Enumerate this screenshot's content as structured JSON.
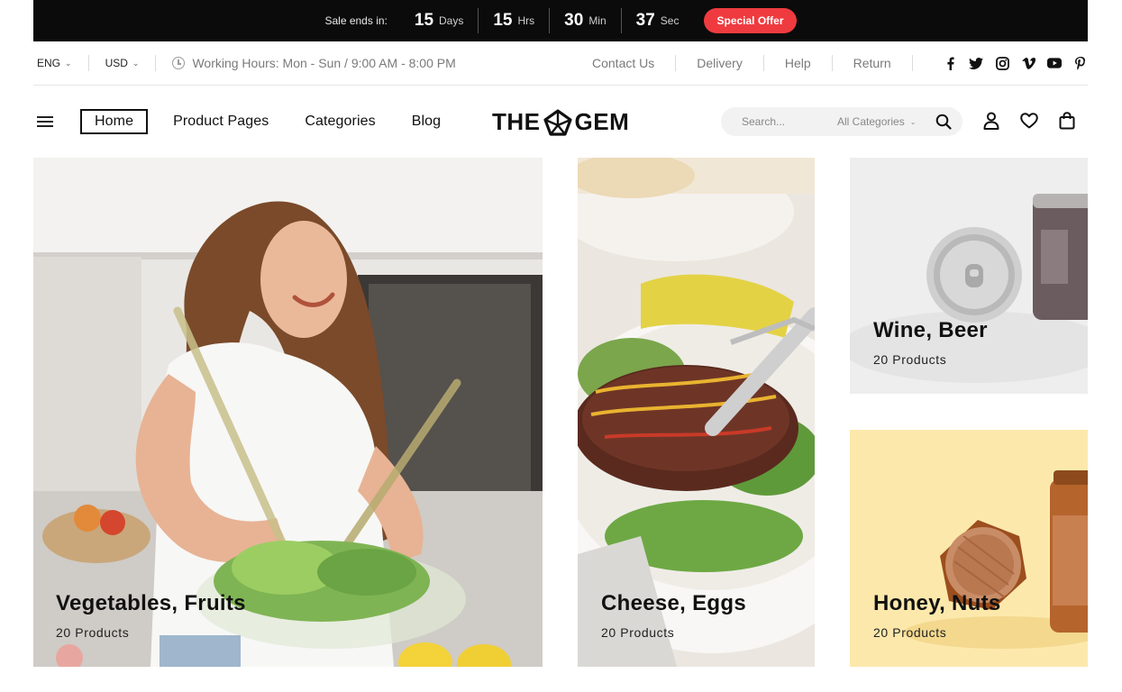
{
  "promo": {
    "sale_label": "Sale ends in:",
    "days": "15",
    "days_label": "Days",
    "hours": "15",
    "hours_label": "Hrs",
    "minutes": "30",
    "minutes_label": "Min",
    "seconds": "37",
    "seconds_label": "Sec",
    "offer_label": "Special Offer",
    "offer_color": "#ef3b40"
  },
  "utility": {
    "language": "ENG",
    "currency": "USD",
    "hours": "Working Hours: Mon - Sun / 9:00 AM - 8:00 PM",
    "links": [
      "Contact Us",
      "Delivery",
      "Help",
      "Return"
    ],
    "social": [
      "facebook-icon",
      "twitter-icon",
      "instagram-icon",
      "vimeo-icon",
      "youtube-icon",
      "pinterest-icon"
    ]
  },
  "nav": {
    "items": [
      "Home",
      "Product Pages",
      "Categories",
      "Blog"
    ],
    "logo_left": "THE",
    "logo_right": "GEM",
    "search_placeholder": "Search...",
    "category_select": "All Categories"
  },
  "tiles": [
    {
      "title": "Vegetables, Fruits",
      "count": "20 Products"
    },
    {
      "title": "Cheese, Eggs",
      "count": "20 Products"
    },
    {
      "title": "Wine, Beer",
      "count": "20 Products"
    },
    {
      "title": "Honey, Nuts",
      "count": "20 Products"
    }
  ]
}
